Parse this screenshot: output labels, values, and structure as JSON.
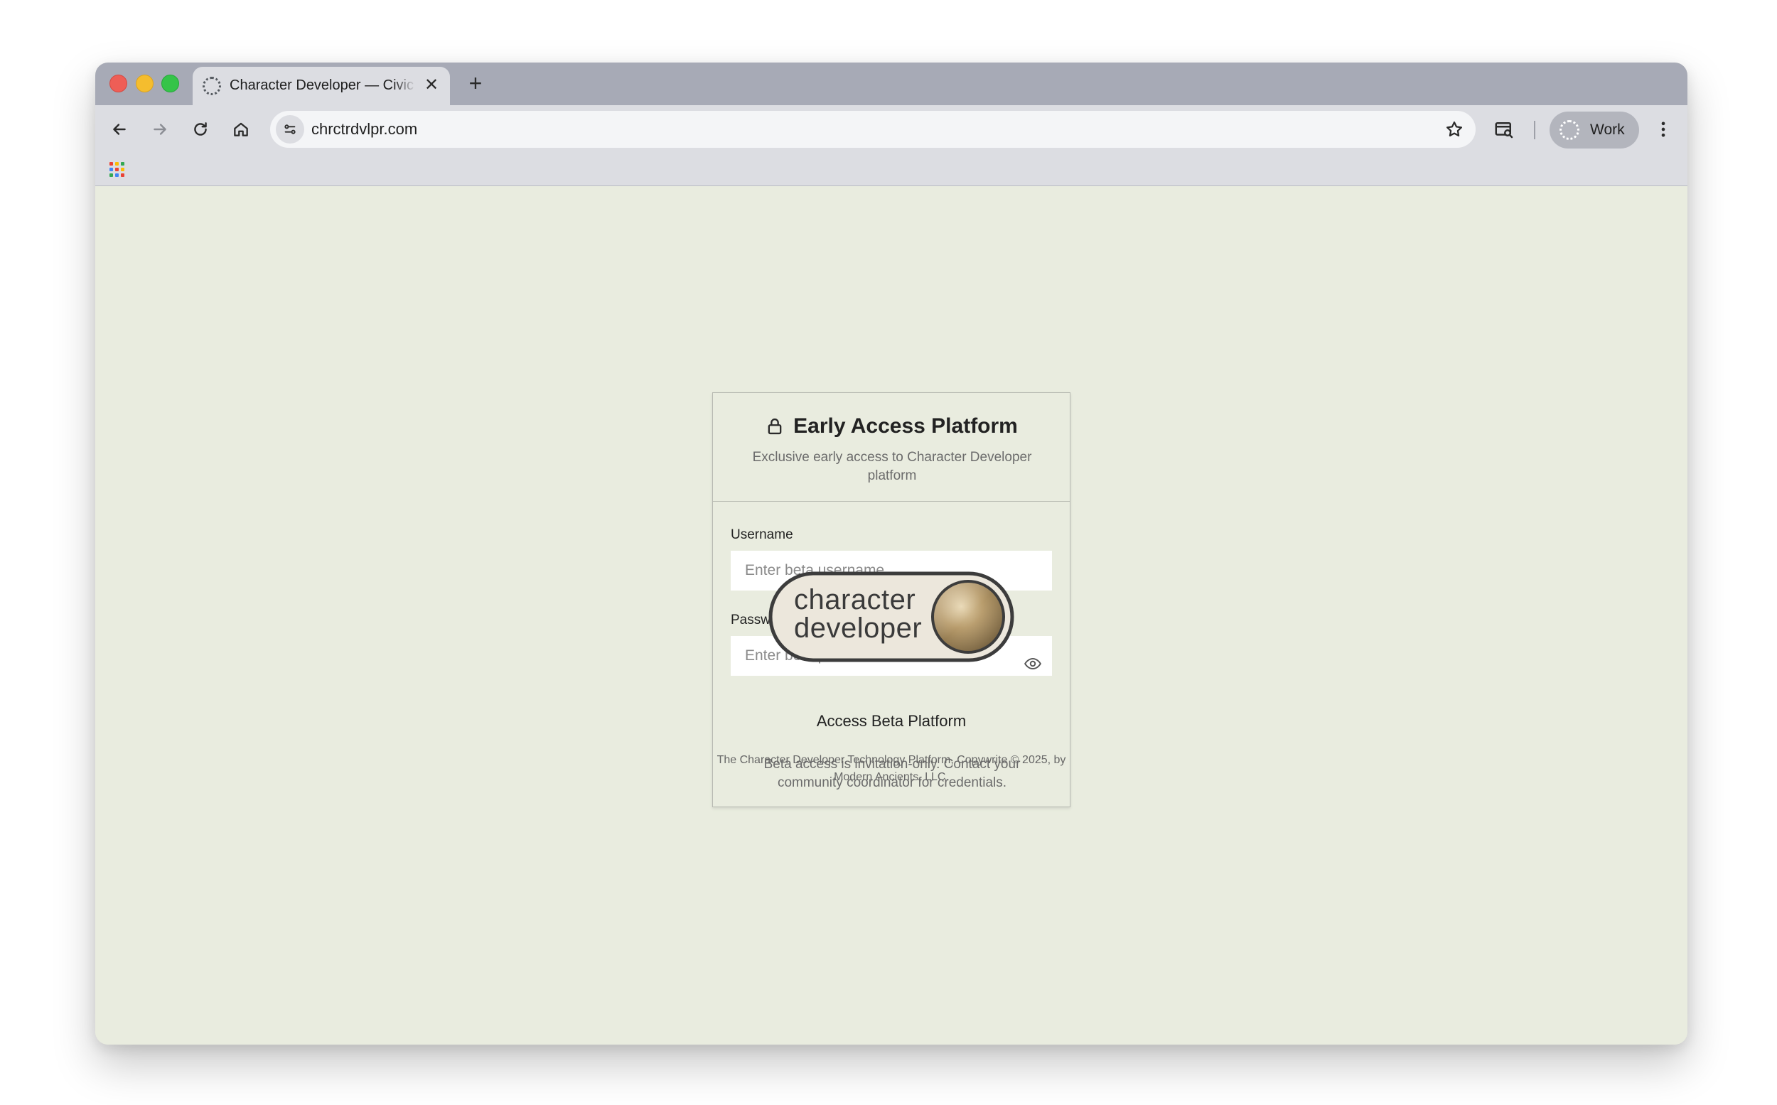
{
  "browser": {
    "tab": {
      "title": "Character Developer — Civic Character Platform",
      "close_icon": "close-icon"
    },
    "new_tab_icon": "plus-icon",
    "toolbar": {
      "back_icon": "arrow-left-icon",
      "forward_icon": "arrow-right-icon",
      "reload_icon": "reload-icon",
      "home_icon": "home-icon",
      "site_settings_icon": "tune-icon",
      "url": "chrctrdvlpr.com",
      "bookmark_icon": "star-icon",
      "reading_mode_icon": "tab-search-icon",
      "profile_label": "Work",
      "menu_icon": "kebab-icon"
    },
    "bookmarks": {
      "apps_icon": "apps-grid-icon"
    }
  },
  "login": {
    "lock_icon": "lock-icon",
    "title": "Early Access Platform",
    "subtitle": "Exclusive early access to Character Developer platform",
    "username_label": "Username",
    "username_placeholder": "Enter beta username",
    "password_label": "Password",
    "password_placeholder": "Enter beta password",
    "toggle_visibility_icon": "eye-icon",
    "submit_label": "Access Beta Platform",
    "note": "Beta access is invitation-only. Contact your community coordinator for credentials."
  },
  "logo": {
    "line1": "character",
    "line2": "developer"
  },
  "footer": {
    "text": "The Character Developer Technology Platform, Copywrite © 2025, by Modern Ancients, LLC."
  },
  "colors": {
    "page_background": "#e9ecdf",
    "tab_strip": "#a7aab6",
    "toolbar": "#dcdde2",
    "logo_gold": "#b39a6d"
  }
}
